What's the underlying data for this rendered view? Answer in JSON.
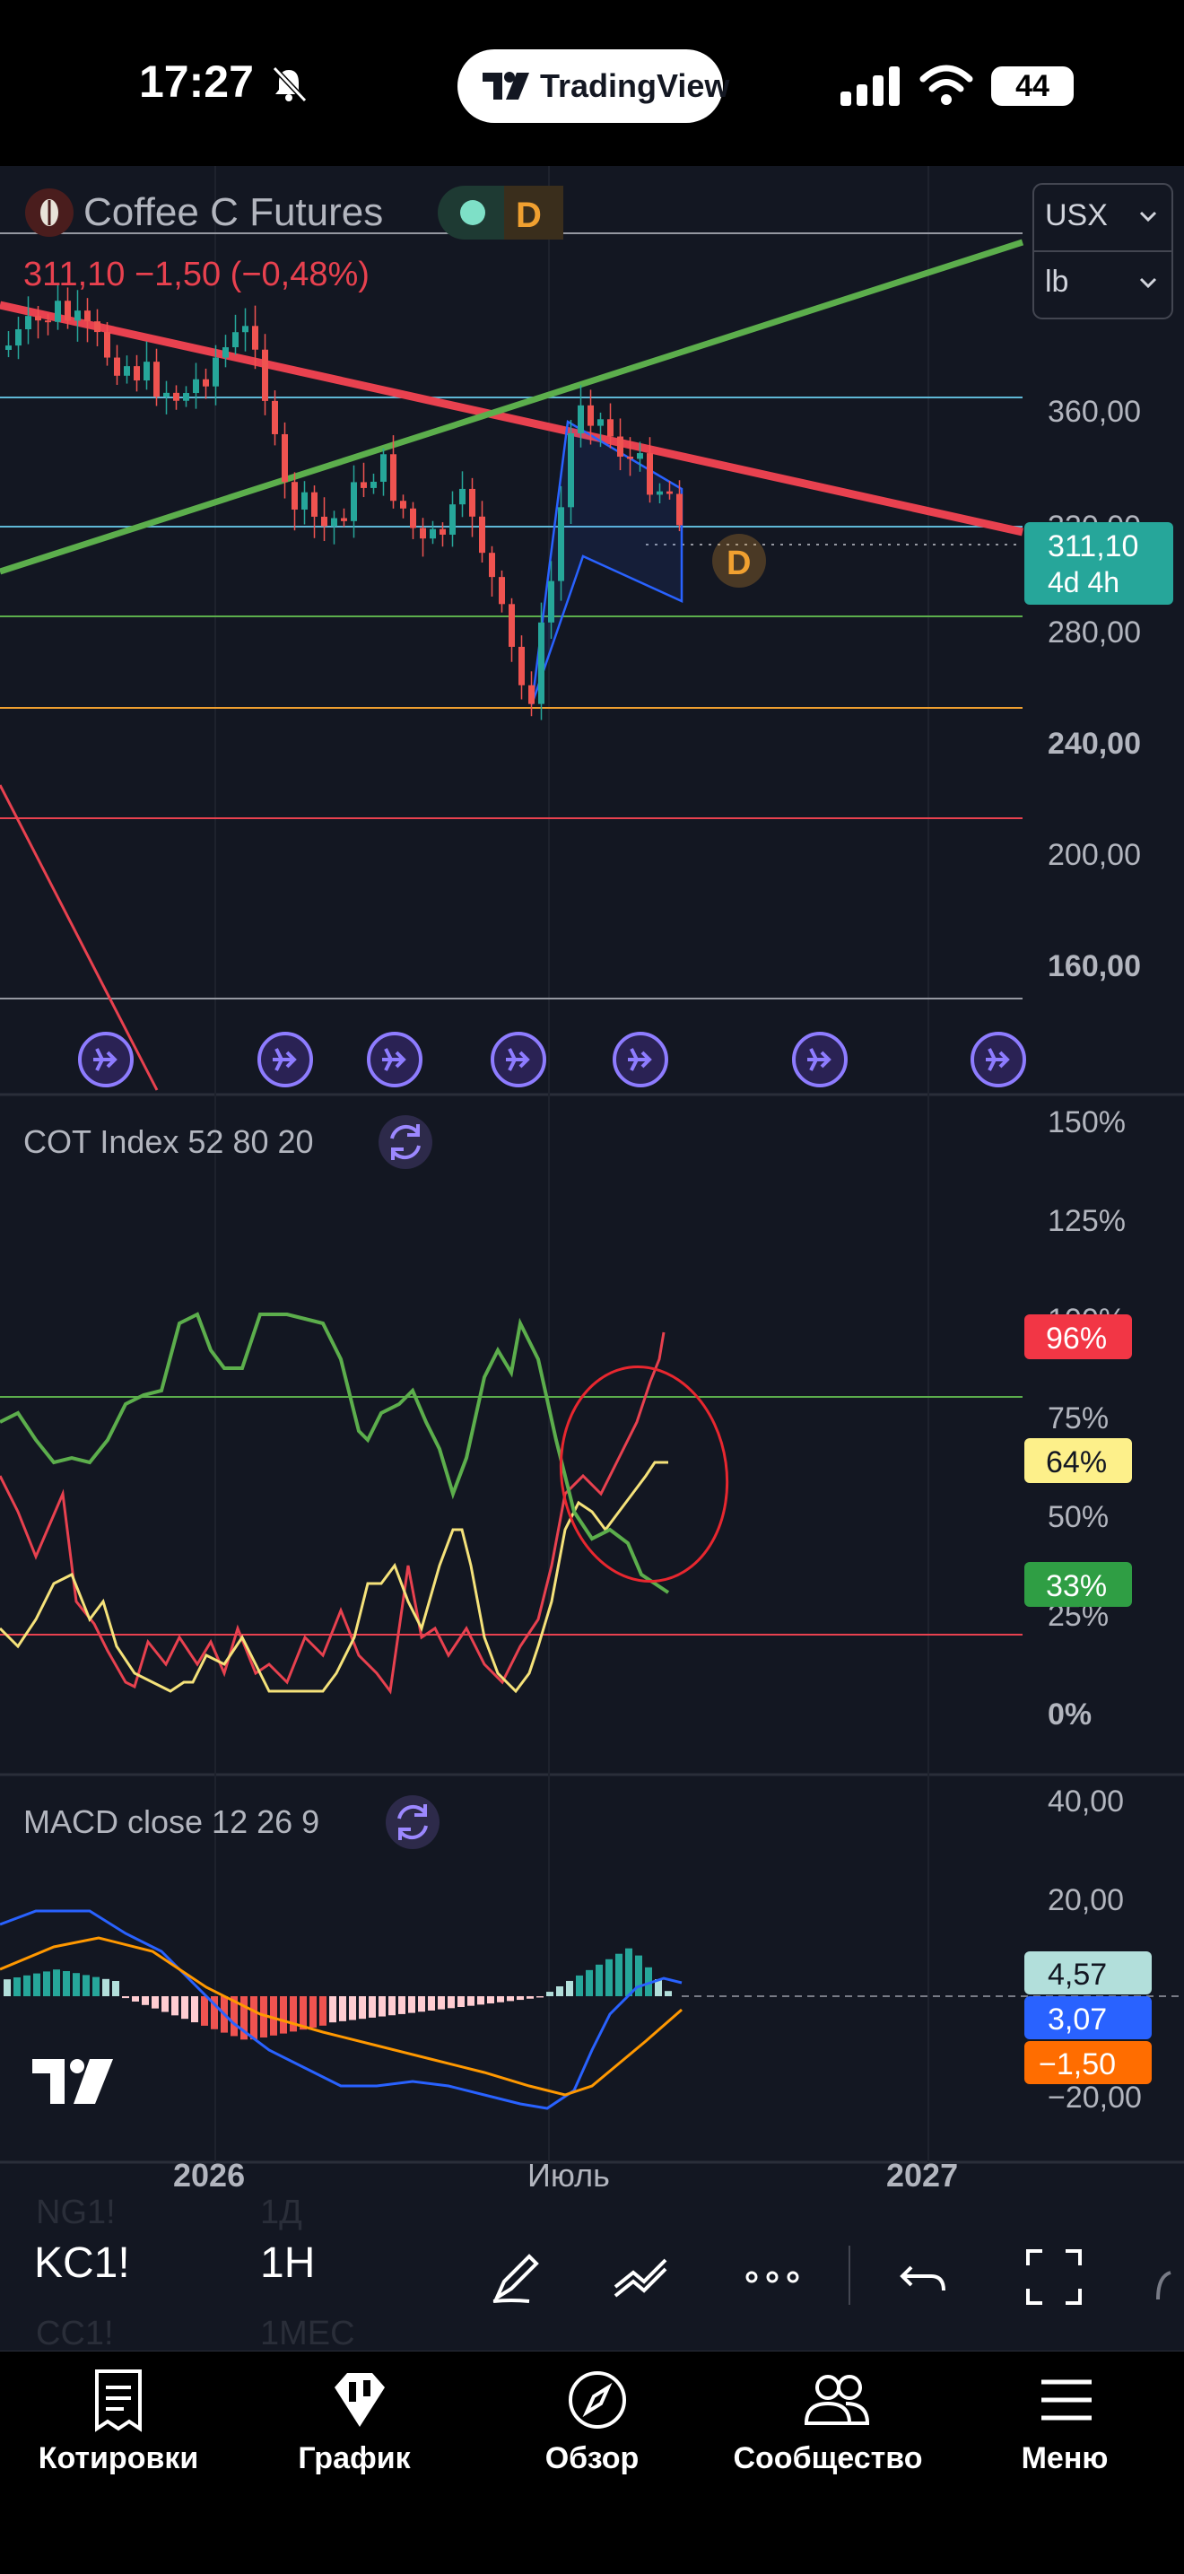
{
  "status_bar": {
    "time": "17:27",
    "battery": "44"
  },
  "app_pill": {
    "label": "TradingView"
  },
  "main_chart": {
    "symbol_name": "Coffee C Futures",
    "interval_badge": "D",
    "quote": "311,10  −1,50 (−0,48%)",
    "currency": "USX",
    "unit": "lb",
    "price_labels": [
      "360,00",
      "320,00",
      "280,00",
      "240,00",
      "200,00",
      "160,00"
    ],
    "last_price": "311,10",
    "countdown": "4d 4h",
    "marker": "D"
  },
  "cot_pane": {
    "title": "COT Index 52 80 20",
    "axis_labels": [
      "150%",
      "125%",
      "100%",
      "75%",
      "50%",
      "25%",
      "0%"
    ],
    "badges": {
      "red": "96%",
      "yellow": "64%",
      "green": "33%"
    }
  },
  "macd_pane": {
    "title": "MACD close  12  26  9",
    "axis_labels": [
      "40,00",
      "20,00",
      "−20,00"
    ],
    "badges": {
      "hist": "4,57",
      "macd": "3,07",
      "signal": "−1,50"
    }
  },
  "time_axis": {
    "labels": [
      "2026",
      "Июль",
      "2027"
    ]
  },
  "toolbar": {
    "symbol": "KC1!",
    "interval": "1H",
    "ghost_symbol_above": "NG1!",
    "ghost_interval_above": "1Д",
    "ghost_symbol_below": "CC1!",
    "ghost_interval_below": "1МЕС"
  },
  "bottom_nav": {
    "items": [
      {
        "label": "Котировки",
        "icon": "document-icon"
      },
      {
        "label": "График",
        "icon": "chart-icon"
      },
      {
        "label": "Обзор",
        "icon": "compass-icon"
      },
      {
        "label": "Сообщество",
        "icon": "community-icon"
      },
      {
        "label": "Меню",
        "icon": "menu-icon"
      }
    ]
  },
  "colors": {
    "background": "#131722",
    "up": "#26a69a",
    "down": "#ef5350",
    "trend_red": "#e8414f",
    "trend_green": "#5cae4c",
    "accent_blue": "#2962ff",
    "macd_signal": "#ff9800"
  }
}
